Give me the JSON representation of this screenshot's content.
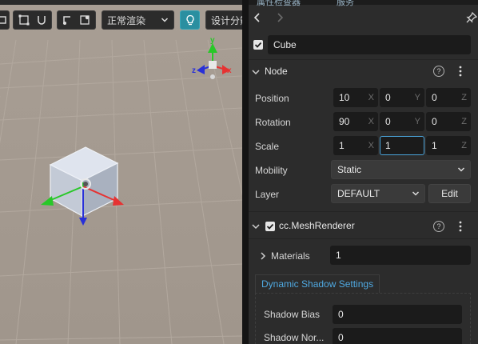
{
  "scene": {
    "render_mode": "正常渲染",
    "design_resolution_label": "设计分辨率",
    "gizmo_axes": {
      "x": "x",
      "y": "y",
      "z": "z"
    },
    "colors": {
      "x": "#e63232",
      "y": "#28c828",
      "z": "#2830d8",
      "accent": "#2a8fa0"
    }
  },
  "inspector": {
    "tabs": [
      "属性检查器",
      "服务"
    ],
    "node_name": "Cube",
    "node_section": {
      "title": "Node",
      "position": {
        "label": "Position",
        "x": "10",
        "y": "0",
        "z": "0"
      },
      "rotation": {
        "label": "Rotation",
        "x": "90",
        "y": "0",
        "z": "0"
      },
      "scale": {
        "label": "Scale",
        "x": "1",
        "y": "1",
        "z": "1"
      },
      "mobility": {
        "label": "Mobility",
        "value": "Static"
      },
      "layer": {
        "label": "Layer",
        "value": "DEFAULT",
        "edit_label": "Edit"
      },
      "axis_labels": {
        "x": "X",
        "y": "Y",
        "z": "Z"
      }
    },
    "mesh_renderer": {
      "title": "cc.MeshRenderer",
      "materials": {
        "label": "Materials",
        "value": "1"
      },
      "shadow_tab": "Dynamic Shadow Settings",
      "shadow_bias": {
        "label": "Shadow Bias",
        "value": "0"
      },
      "shadow_normal_bias": {
        "label": "Shadow Nor...",
        "value": "0"
      }
    },
    "help_glyph": "?"
  }
}
